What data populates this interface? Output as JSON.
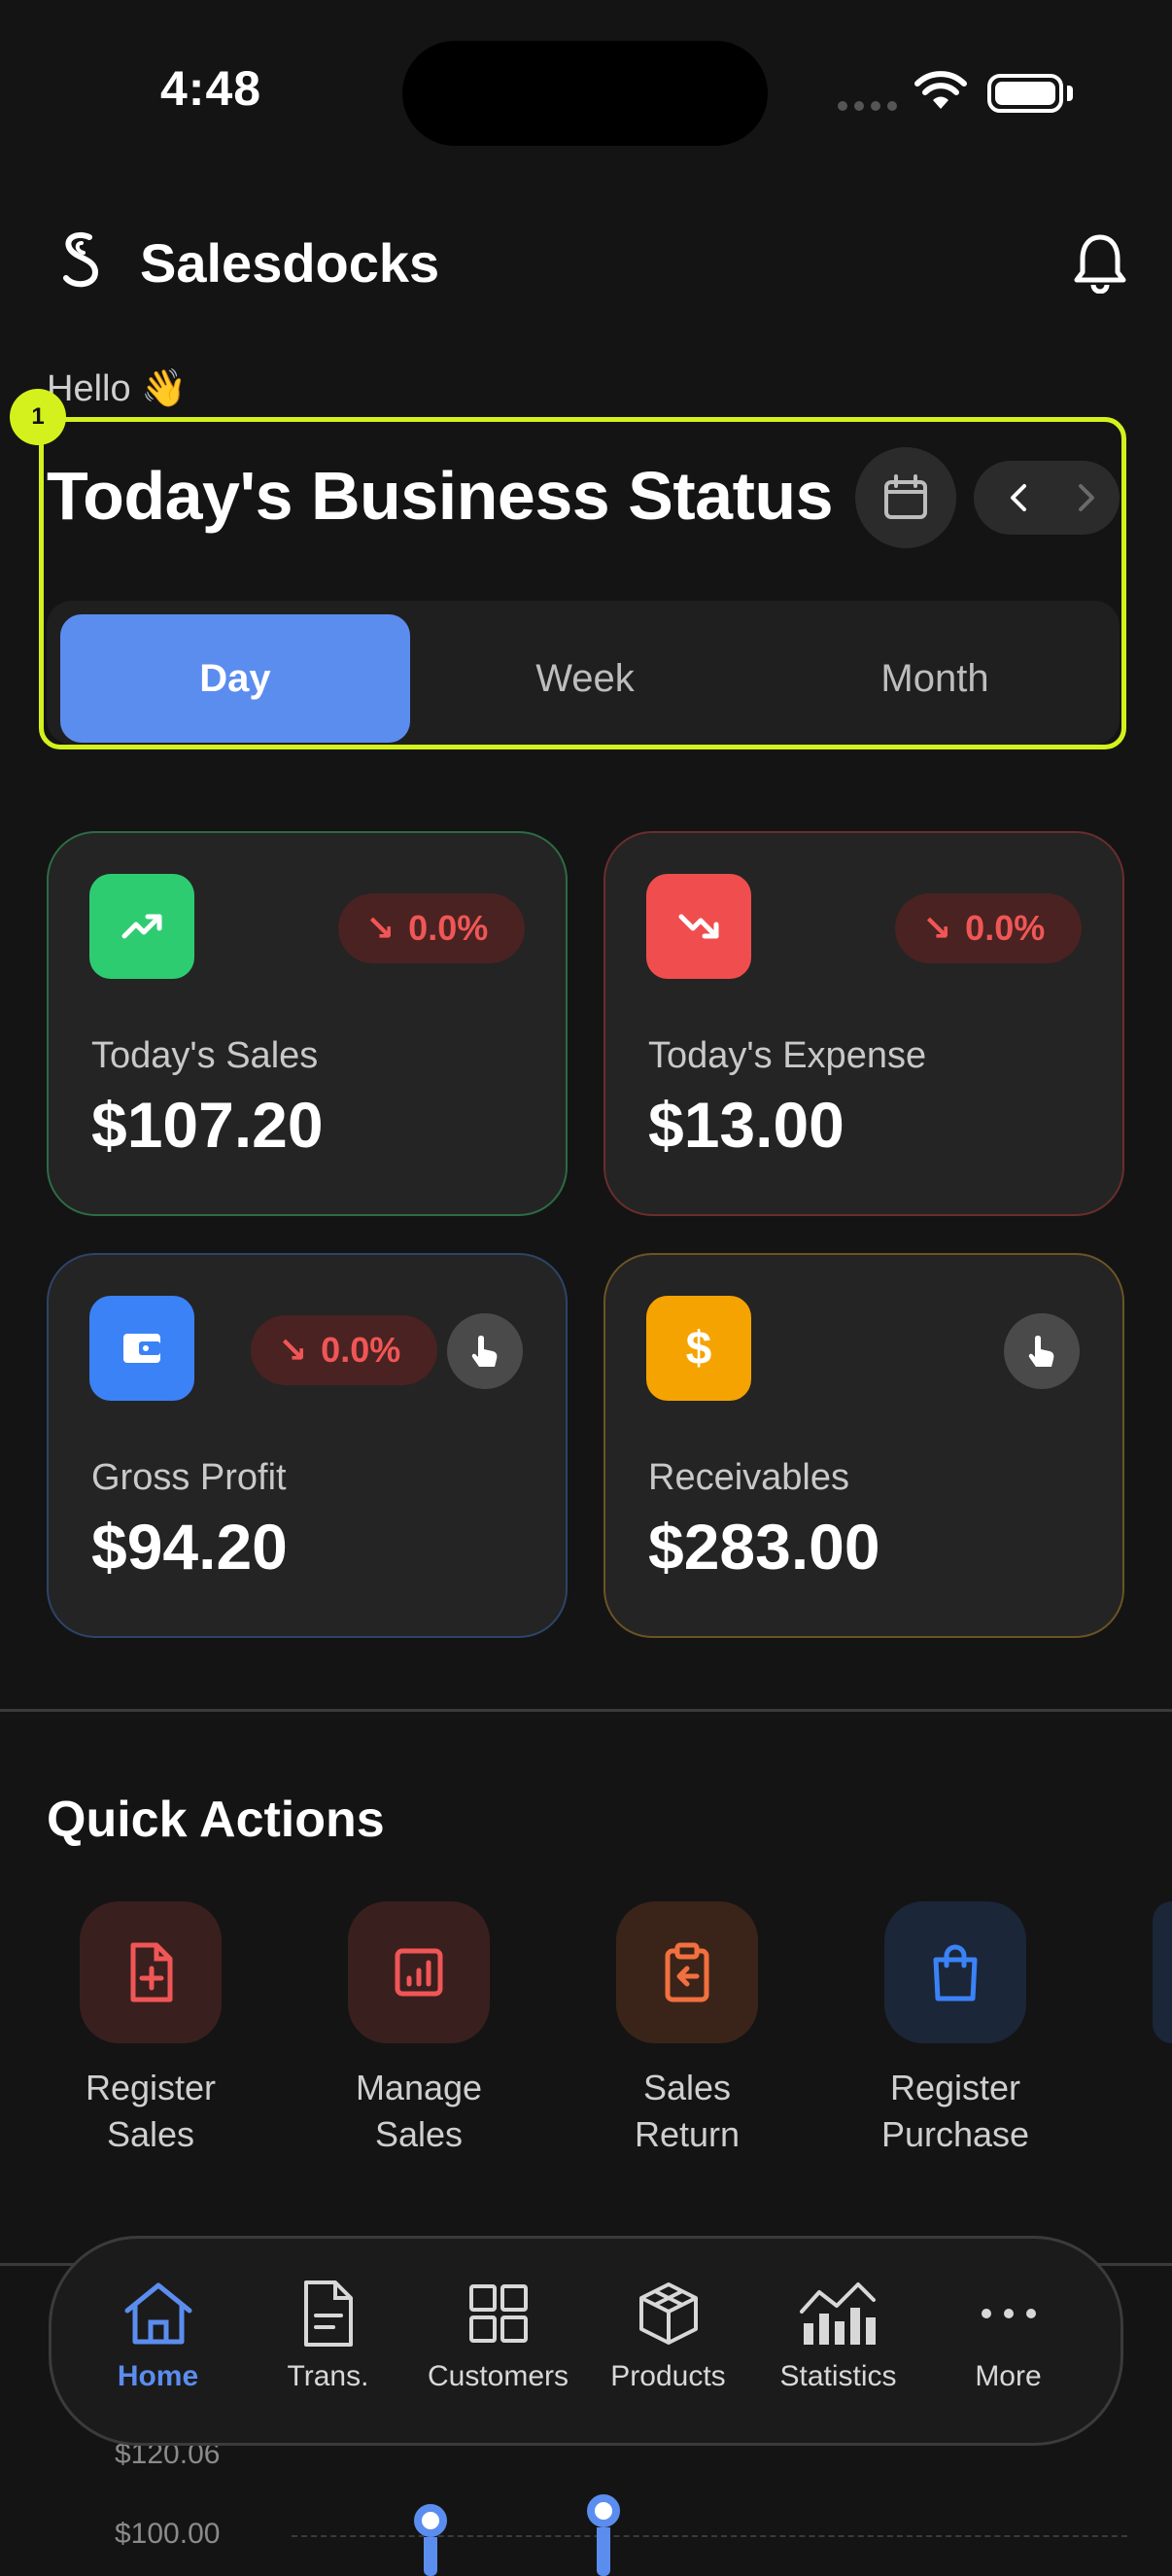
{
  "status_bar": {
    "time": "4:48"
  },
  "header": {
    "app_name": "Salesdocks"
  },
  "greeting": "Hello 👋",
  "focus_badge": "1",
  "business_status": {
    "title": "Today's Business Status",
    "tabs": [
      {
        "label": "Day",
        "active": true
      },
      {
        "label": "Week",
        "active": false
      },
      {
        "label": "Month",
        "active": false
      }
    ]
  },
  "stats": {
    "sales": {
      "label": "Today's Sales",
      "value": "$107.20",
      "change": "0.0%",
      "accent": "#2ecc71"
    },
    "expense": {
      "label": "Today's Expense",
      "value": "$13.00",
      "change": "0.0%",
      "accent": "#f04e4e"
    },
    "gross_profit": {
      "label": "Gross Profit",
      "value": "$94.20",
      "change": "0.0%",
      "accent": "#3b82f6"
    },
    "receivables": {
      "label": "Receivables",
      "value": "$283.00",
      "accent": "#f5a300"
    }
  },
  "quick_actions": {
    "title": "Quick Actions",
    "items": [
      {
        "label": "Register\nSales",
        "icon": "file-plus-icon"
      },
      {
        "label": "Manage\nSales",
        "icon": "report-icon"
      },
      {
        "label": "Sales\nReturn",
        "icon": "clipboard-return-icon"
      },
      {
        "label": "Register\nPurchase",
        "icon": "shopping-bag-icon"
      }
    ]
  },
  "chart_peek": {
    "y_ticks": [
      "$120.06",
      "$100.00"
    ]
  },
  "bottom_nav": [
    {
      "label": "Home",
      "icon": "home-icon",
      "active": true
    },
    {
      "label": "Trans.",
      "icon": "document-icon",
      "active": false
    },
    {
      "label": "Customers",
      "icon": "grid-icon",
      "active": false
    },
    {
      "label": "Products",
      "icon": "box-icon",
      "active": false
    },
    {
      "label": "Statistics",
      "icon": "bar-chart-icon",
      "active": false
    },
    {
      "label": "More",
      "icon": "more-icon",
      "active": false
    }
  ],
  "colors": {
    "accent": "#5b8def",
    "highlight": "#d4f11d",
    "negative": "#f05656"
  }
}
